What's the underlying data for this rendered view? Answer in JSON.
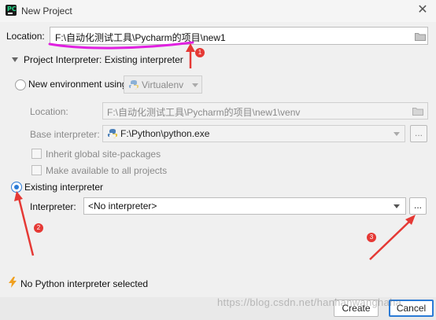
{
  "window": {
    "title": "New Project",
    "close_symbol": "✕"
  },
  "location": {
    "label": "Location:",
    "value": "F:\\自动化测试工具\\Pycharm的项目\\new1"
  },
  "section": {
    "title": "Project Interpreter: Existing interpreter"
  },
  "new_env": {
    "radio_label": "New environment using",
    "tool_value": "Virtualenv",
    "location_label": "Location:",
    "location_value": "F:\\自动化测试工具\\Pycharm的项目\\new1\\venv",
    "base_label": "Base interpreter:",
    "base_value": "F:\\Python\\python.exe",
    "inherit_label": "Inherit global site-packages",
    "make_available_label": "Make available to all projects"
  },
  "existing": {
    "radio_label": "Existing interpreter",
    "interpreter_label": "Interpreter:",
    "interpreter_value": "<No interpreter>",
    "ellipsis": "..."
  },
  "status": {
    "warning": "No Python interpreter selected"
  },
  "buttons": {
    "create": "Create",
    "cancel": "Cancel",
    "browse": "..."
  },
  "watermark": "https://blog.csdn.net/hanhanwanghaha",
  "annotations": [
    "1",
    "2",
    "3"
  ],
  "colors": {
    "accent": "#2b7bd6",
    "annotation_red": "#e53935",
    "highlight": "#e020e0",
    "warning": "#f0a020"
  }
}
